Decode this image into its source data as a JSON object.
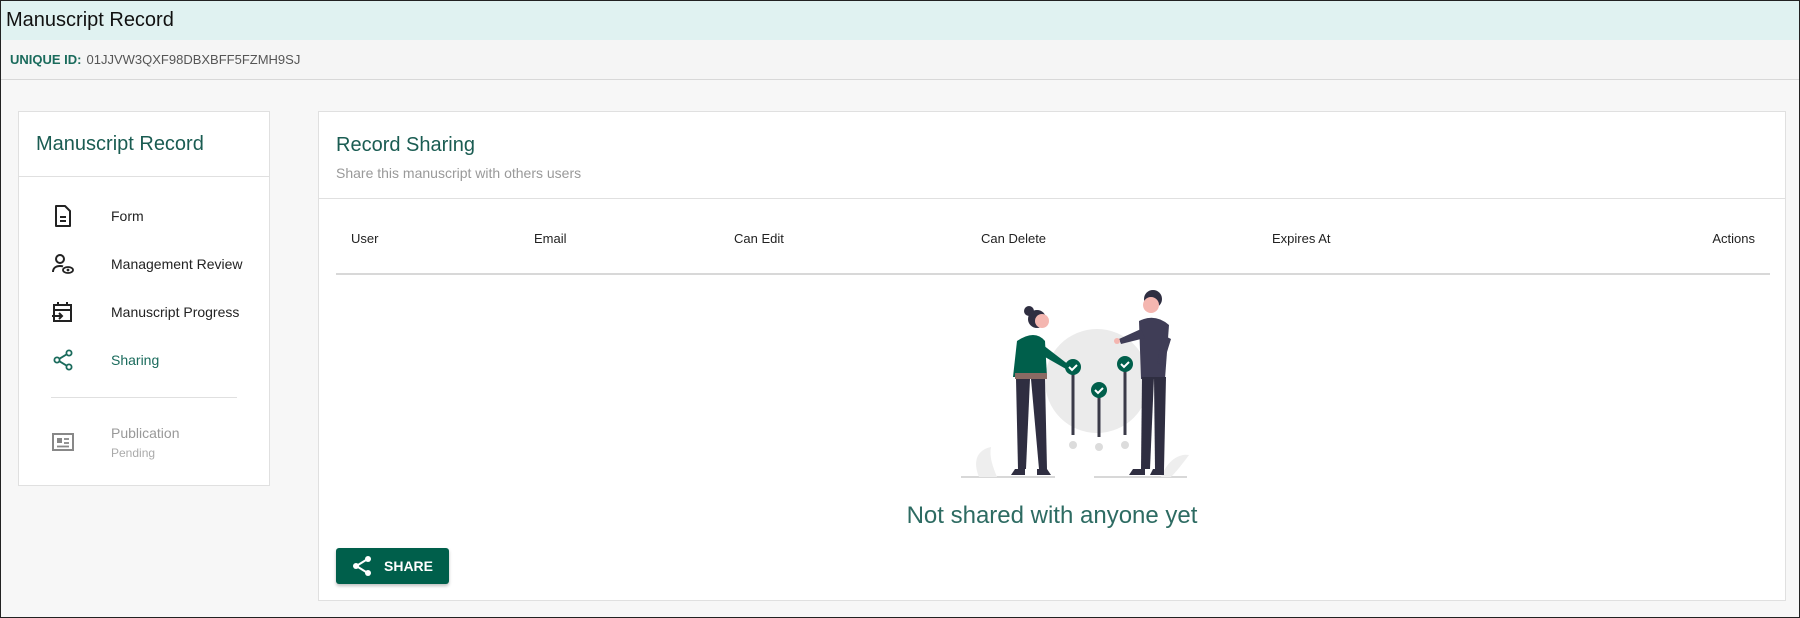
{
  "window": {
    "title": "Manuscript Record"
  },
  "record": {
    "id_label": "UNIQUE ID:",
    "id_value": "01JJVW3QXF98DBXBFF5FZMH9SJ"
  },
  "sidebar": {
    "title": "Manuscript Record",
    "items": [
      {
        "label": "Form",
        "icon": "document-icon"
      },
      {
        "label": "Management Review",
        "icon": "user-eye-icon"
      },
      {
        "label": "Manuscript Progress",
        "icon": "calendar-arrow-icon"
      },
      {
        "label": "Sharing",
        "icon": "share-icon",
        "active": true
      }
    ],
    "publication": {
      "label": "Publication",
      "status": "Pending",
      "icon": "newspaper-icon"
    }
  },
  "sharing": {
    "title": "Record Sharing",
    "subtitle": "Share this manuscript with others users",
    "columns": [
      "User",
      "Email",
      "Can Edit",
      "Can Delete",
      "Expires At",
      "Actions"
    ],
    "empty_text": "Not shared with anyone yet",
    "share_button": "SHARE"
  },
  "colors": {
    "accent": "#005f4b",
    "title_teal": "#1a5c52",
    "titlebar_bg": "#e0f2f1"
  }
}
